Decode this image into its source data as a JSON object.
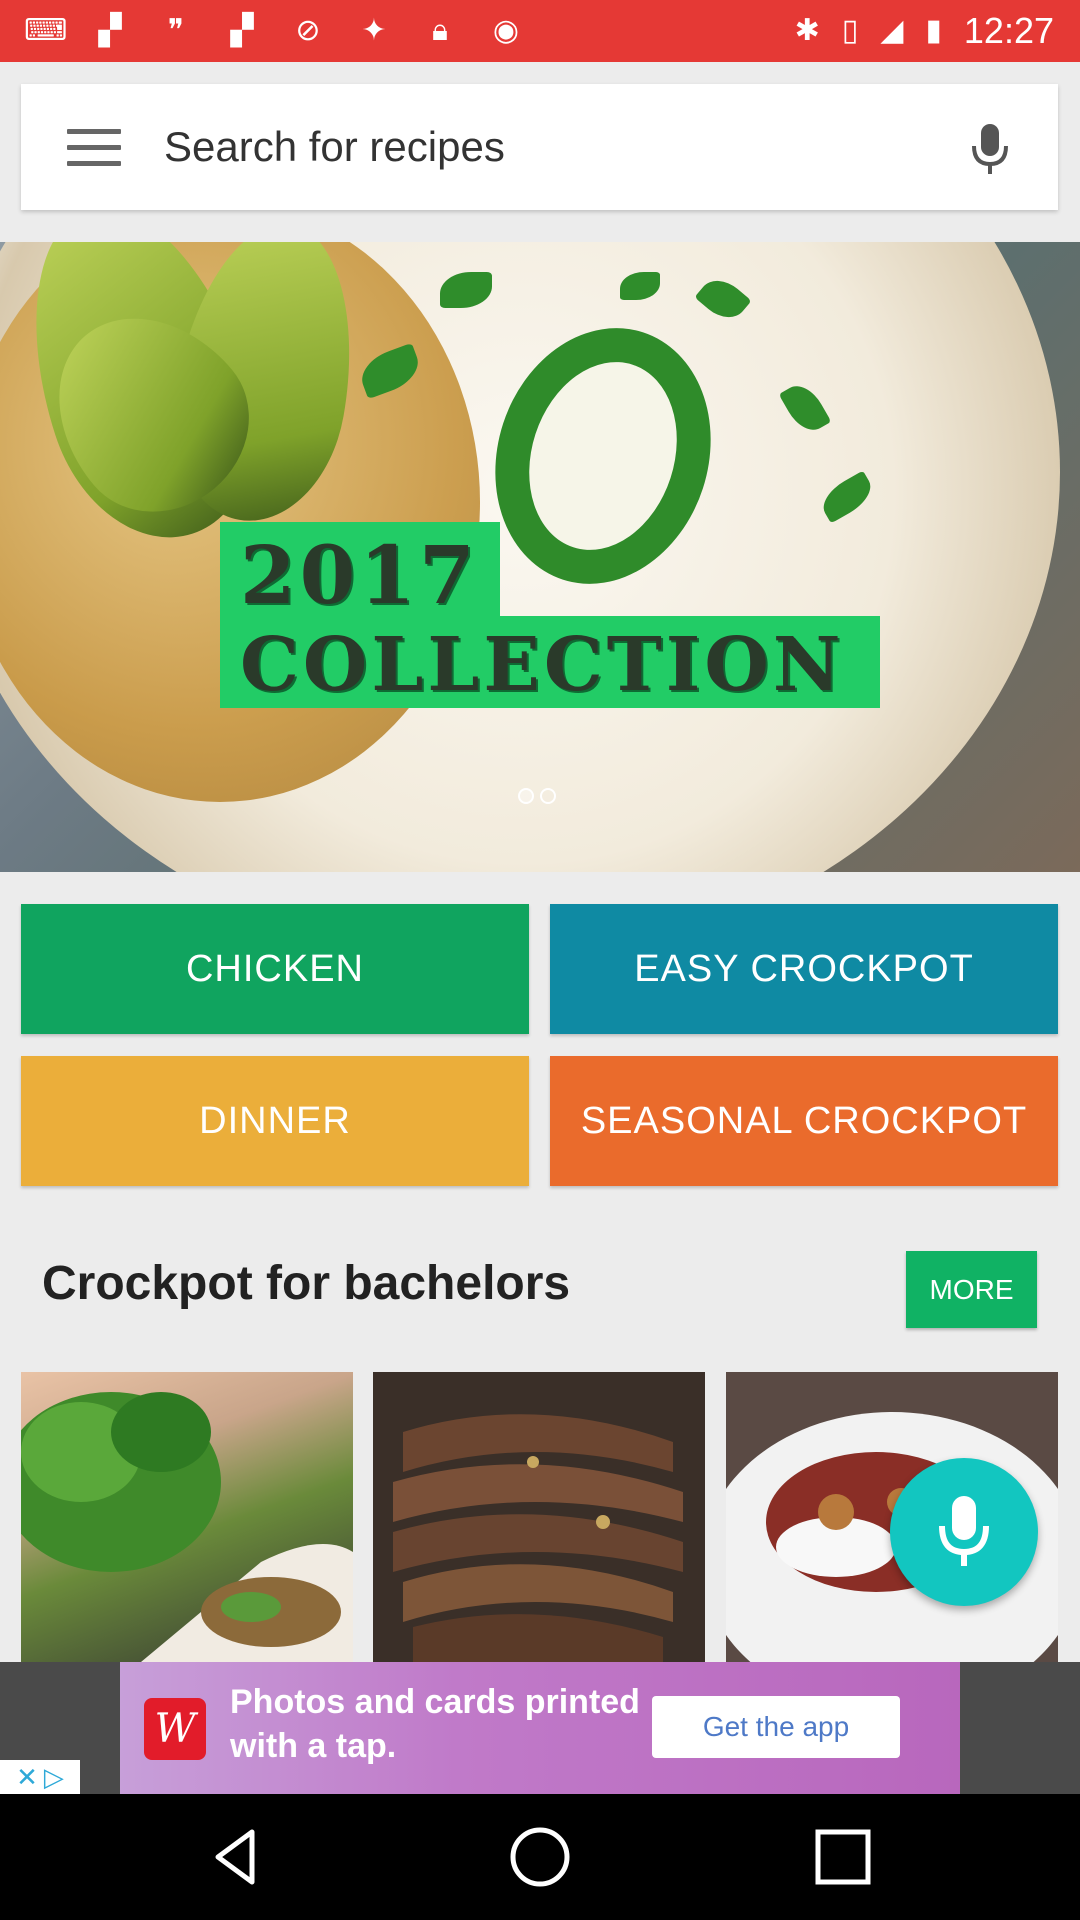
{
  "status_bar": {
    "left_icons": [
      "keyboard-icon",
      "flipboard-icon",
      "hangouts-icon",
      "flipboard-icon",
      "blocked-icon",
      "beats-icon",
      "lock-icon",
      "game-icon"
    ],
    "right_icons": [
      "bluetooth-icon",
      "no-sim-icon",
      "signal-icon",
      "battery-icon"
    ],
    "time": "12:27",
    "color": "#e53935"
  },
  "search": {
    "placeholder": "Search for recipes"
  },
  "hero": {
    "line1": "2017",
    "line2": "COLLECTION",
    "page_count": 2,
    "active_page": 1
  },
  "categories": [
    {
      "label": "CHICKEN",
      "color": "#10a45f"
    },
    {
      "label": "EASY CROCKPOT",
      "color": "#0f8aa3"
    },
    {
      "label": "DINNER",
      "color": "#ebae3a"
    },
    {
      "label": "SEASONAL CROCKPOT",
      "color": "#ea6b2c"
    }
  ],
  "section": {
    "title": "Crockpot for bachelors",
    "more_label": "MORE"
  },
  "ad": {
    "logo": "W",
    "text": "Photos and cards printed with a tap.",
    "cta": "Get the app"
  },
  "colors": {
    "accent_green": "#10b264",
    "fab": "#12c6c0"
  }
}
